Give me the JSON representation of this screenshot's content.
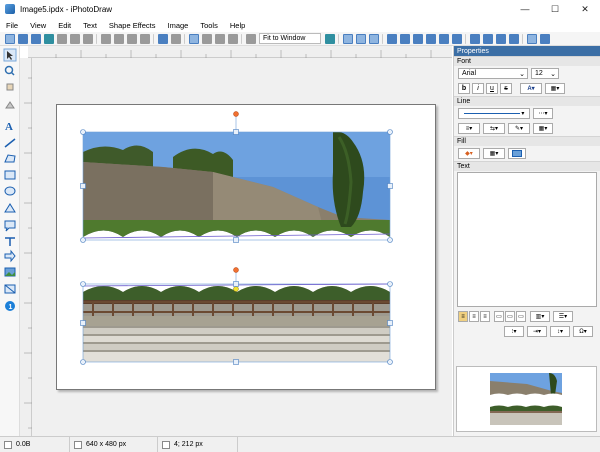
{
  "window": {
    "title": "Image5.ipdx - iPhotoDraw",
    "controls": [
      "—",
      "☐",
      "✕"
    ]
  },
  "menu": [
    "File",
    "View",
    "Edit",
    "Text",
    "Shape Effects",
    "Image",
    "Tools",
    "Help"
  ],
  "toolbar": {
    "zoom_value": "Fit to Window"
  },
  "properties": {
    "header": "Properties",
    "font_section": "Font",
    "font_name": "Arial",
    "font_size": "12",
    "style_buttons": [
      "b",
      "i",
      "u",
      "s"
    ],
    "line_section": "Line",
    "fill_section": "Fill",
    "text_section": "Text"
  },
  "status": {
    "file_size": "0.0B",
    "image_size": "640 x 480 px",
    "cursor_pos": "4; 212 px"
  },
  "colors": {
    "accent": "#3b6ea5",
    "handle": "#4a7fc0",
    "rotate_handle": "#f07030"
  }
}
